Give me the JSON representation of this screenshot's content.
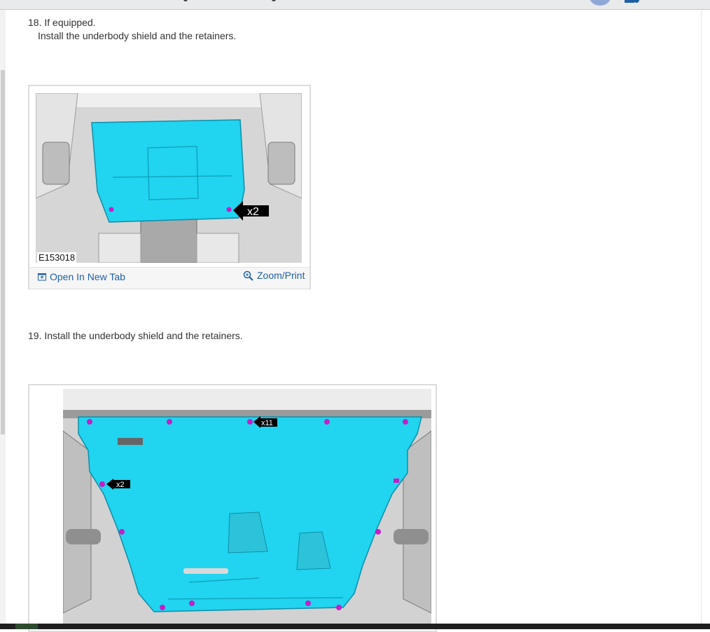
{
  "steps": [
    {
      "number": "18.",
      "line1": "If equipped.",
      "line2": "Install the underbody shield and the retainers.",
      "figure": {
        "code": "E153018",
        "callout": "x2",
        "open_tab_label": "Open In New Tab",
        "zoom_label": "Zoom/Print"
      }
    },
    {
      "number": "19.",
      "text": "Install the underbody shield and the retainers.",
      "figure": {
        "callout_top": "x11",
        "callout_left": "x2"
      }
    }
  ],
  "colors": {
    "shield": "#21d4ef",
    "retainer": "#c21fc9",
    "link": "#1f5fa8"
  },
  "icons": [
    "open-in-new-tab-icon",
    "zoom-icon"
  ]
}
